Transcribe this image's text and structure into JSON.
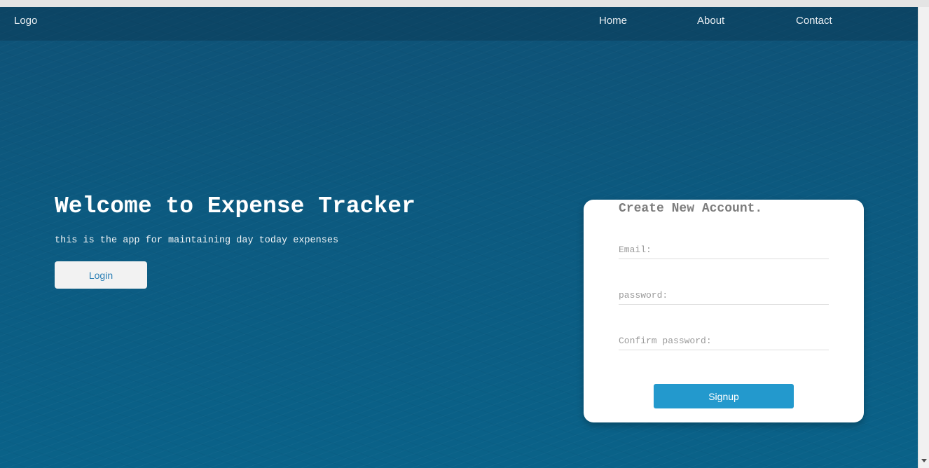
{
  "nav": {
    "logo": "Logo",
    "links": [
      "Home",
      "About",
      "Contact"
    ]
  },
  "hero": {
    "title": "Welcome to Expense Tracker",
    "subtitle": "this is the app for maintaining day today expenses",
    "login_label": "Login"
  },
  "signup_form": {
    "title": "Create New Account.",
    "email_placeholder": "Email:",
    "password_placeholder": "password:",
    "confirm_placeholder": "Confirm password:",
    "signup_label": "Signup"
  },
  "colors": {
    "background": "#0c5a80",
    "signup_button": "#2399cd",
    "login_text": "#2b7fb5"
  }
}
